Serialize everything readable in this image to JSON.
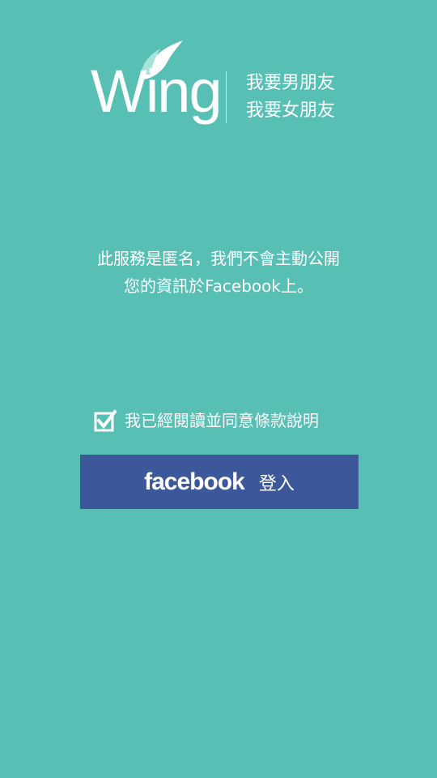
{
  "logo": {
    "wordmark": "Wing",
    "feather_icon": "wing-feather-icon",
    "taglines": [
      "我要男朋友",
      "我要女朋友"
    ]
  },
  "notice": {
    "lines": [
      "此服務是匿名，我們不會主動公開",
      "您的資訊於Facebook上。"
    ]
  },
  "agreement": {
    "checked": true,
    "label": "我已經閱讀並同意條款說明",
    "icon": "checkbox-checked-icon"
  },
  "login_button": {
    "brand": "facebook",
    "label": "登入"
  },
  "colors": {
    "background": "#57bfb3",
    "facebook_blue": "#3d589a",
    "text": "#ffffff"
  }
}
